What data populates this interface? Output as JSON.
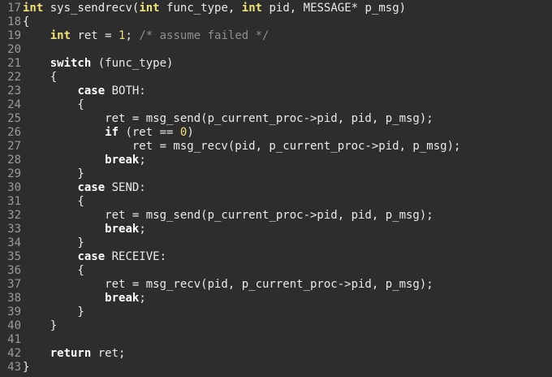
{
  "editor": {
    "lines": [
      {
        "n": "17",
        "tokens": [
          {
            "t": "int",
            "k": "kw"
          },
          {
            "t": " sys_sendrecv(",
            "k": "tx"
          },
          {
            "t": "int",
            "k": "kw"
          },
          {
            "t": " func_type, ",
            "k": "tx"
          },
          {
            "t": "int",
            "k": "kw"
          },
          {
            "t": " pid, MESSAGE* p_msg)",
            "k": "tx"
          }
        ]
      },
      {
        "n": "18",
        "tokens": [
          {
            "t": "{",
            "k": "tx"
          }
        ]
      },
      {
        "n": "19",
        "tokens": [
          {
            "t": "    ",
            "k": "tx"
          },
          {
            "t": "int",
            "k": "kw"
          },
          {
            "t": " ret = ",
            "k": "tx"
          },
          {
            "t": "1",
            "k": "num"
          },
          {
            "t": "; ",
            "k": "tx"
          },
          {
            "t": "/* assume failed */",
            "k": "cm"
          }
        ]
      },
      {
        "n": "20",
        "tokens": [
          {
            "t": "",
            "k": "tx"
          }
        ]
      },
      {
        "n": "21",
        "tokens": [
          {
            "t": "    ",
            "k": "tx"
          },
          {
            "t": "switch",
            "k": "kw2"
          },
          {
            "t": " (func_type)",
            "k": "tx"
          }
        ]
      },
      {
        "n": "22",
        "tokens": [
          {
            "t": "    {",
            "k": "tx"
          }
        ]
      },
      {
        "n": "23",
        "tokens": [
          {
            "t": "        ",
            "k": "tx"
          },
          {
            "t": "case",
            "k": "kw2"
          },
          {
            "t": " BOTH:",
            "k": "tx"
          }
        ]
      },
      {
        "n": "24",
        "tokens": [
          {
            "t": "        {",
            "k": "tx"
          }
        ]
      },
      {
        "n": "25",
        "tokens": [
          {
            "t": "            ret = msg_send(p_current_proc->pid, pid, p_msg);",
            "k": "tx"
          }
        ]
      },
      {
        "n": "26",
        "tokens": [
          {
            "t": "            ",
            "k": "tx"
          },
          {
            "t": "if",
            "k": "kw2"
          },
          {
            "t": " (ret == ",
            "k": "tx"
          },
          {
            "t": "0",
            "k": "num"
          },
          {
            "t": ")",
            "k": "tx"
          }
        ]
      },
      {
        "n": "27",
        "tokens": [
          {
            "t": "                ret = msg_recv(pid, p_current_proc->pid, p_msg);",
            "k": "tx"
          }
        ]
      },
      {
        "n": "28",
        "tokens": [
          {
            "t": "            ",
            "k": "tx"
          },
          {
            "t": "break",
            "k": "kw2"
          },
          {
            "t": ";",
            "k": "tx"
          }
        ]
      },
      {
        "n": "29",
        "tokens": [
          {
            "t": "        }",
            "k": "tx"
          }
        ]
      },
      {
        "n": "30",
        "tokens": [
          {
            "t": "        ",
            "k": "tx"
          },
          {
            "t": "case",
            "k": "kw2"
          },
          {
            "t": " SEND:",
            "k": "tx"
          }
        ]
      },
      {
        "n": "31",
        "tokens": [
          {
            "t": "        {",
            "k": "tx"
          }
        ]
      },
      {
        "n": "32",
        "tokens": [
          {
            "t": "            ret = msg_send(p_current_proc->pid, pid, p_msg);",
            "k": "tx"
          }
        ]
      },
      {
        "n": "33",
        "tokens": [
          {
            "t": "            ",
            "k": "tx"
          },
          {
            "t": "break",
            "k": "kw2"
          },
          {
            "t": ";",
            "k": "tx"
          }
        ]
      },
      {
        "n": "34",
        "tokens": [
          {
            "t": "        }",
            "k": "tx"
          }
        ]
      },
      {
        "n": "35",
        "tokens": [
          {
            "t": "        ",
            "k": "tx"
          },
          {
            "t": "case",
            "k": "kw2"
          },
          {
            "t": " RECEIVE:",
            "k": "tx"
          }
        ]
      },
      {
        "n": "36",
        "tokens": [
          {
            "t": "        {",
            "k": "tx"
          }
        ]
      },
      {
        "n": "37",
        "tokens": [
          {
            "t": "            ret = msg_recv(pid, p_current_proc->pid, p_msg);",
            "k": "tx"
          }
        ]
      },
      {
        "n": "38",
        "tokens": [
          {
            "t": "            ",
            "k": "tx"
          },
          {
            "t": "break",
            "k": "kw2"
          },
          {
            "t": ";",
            "k": "tx"
          }
        ]
      },
      {
        "n": "39",
        "tokens": [
          {
            "t": "        }",
            "k": "tx"
          }
        ]
      },
      {
        "n": "40",
        "tokens": [
          {
            "t": "    }",
            "k": "tx"
          }
        ]
      },
      {
        "n": "41",
        "tokens": [
          {
            "t": "",
            "k": "tx"
          }
        ]
      },
      {
        "n": "42",
        "tokens": [
          {
            "t": "    ",
            "k": "tx"
          },
          {
            "t": "return",
            "k": "kw2"
          },
          {
            "t": " ret;",
            "k": "tx"
          }
        ]
      },
      {
        "n": "43",
        "tokens": [
          {
            "t": "}",
            "k": "tx"
          }
        ]
      }
    ]
  },
  "colors": {
    "background": "#2d2d2d",
    "line_number": "#9a9a9a",
    "type_keyword": "#f0e07a",
    "control_keyword": "#ffffff",
    "number": "#f0e07a",
    "comment": "#8e8e8e",
    "text": "#eaeaea"
  }
}
